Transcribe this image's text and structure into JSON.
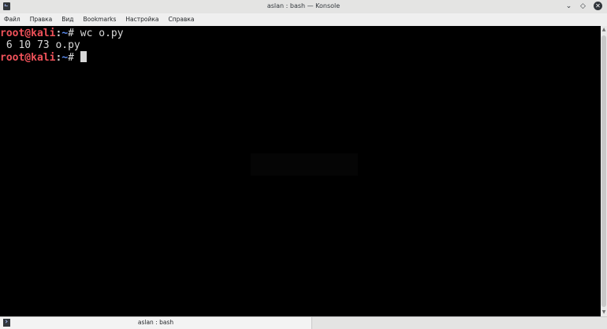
{
  "window": {
    "title": "aslan : bash — Konsole",
    "controls": {
      "chevron": "⌄",
      "diamond": "◇",
      "close": "✕"
    }
  },
  "menu": [
    "Файл",
    "Правка",
    "Вид",
    "Bookmarks",
    "Настройка",
    "Справка"
  ],
  "terminal": {
    "lines": [
      {
        "user_host": "root@kali",
        "sep": ":",
        "path": "~",
        "hash": "# ",
        "command": "wc o.py"
      },
      {
        "output": " 6 10 73 o.py"
      },
      {
        "user_host": "root@kali",
        "sep": ":",
        "path": "~",
        "hash": "# ",
        "command": ""
      }
    ]
  },
  "tab": {
    "label": "aslan : bash"
  },
  "colors": {
    "prompt_user": "#f0525a",
    "prompt_path": "#5c8cf0",
    "terminal_bg": "#000000",
    "terminal_fg": "#d8d8d8"
  },
  "icons": {
    "app": "konsole-icon",
    "tab": "terminal-icon"
  }
}
